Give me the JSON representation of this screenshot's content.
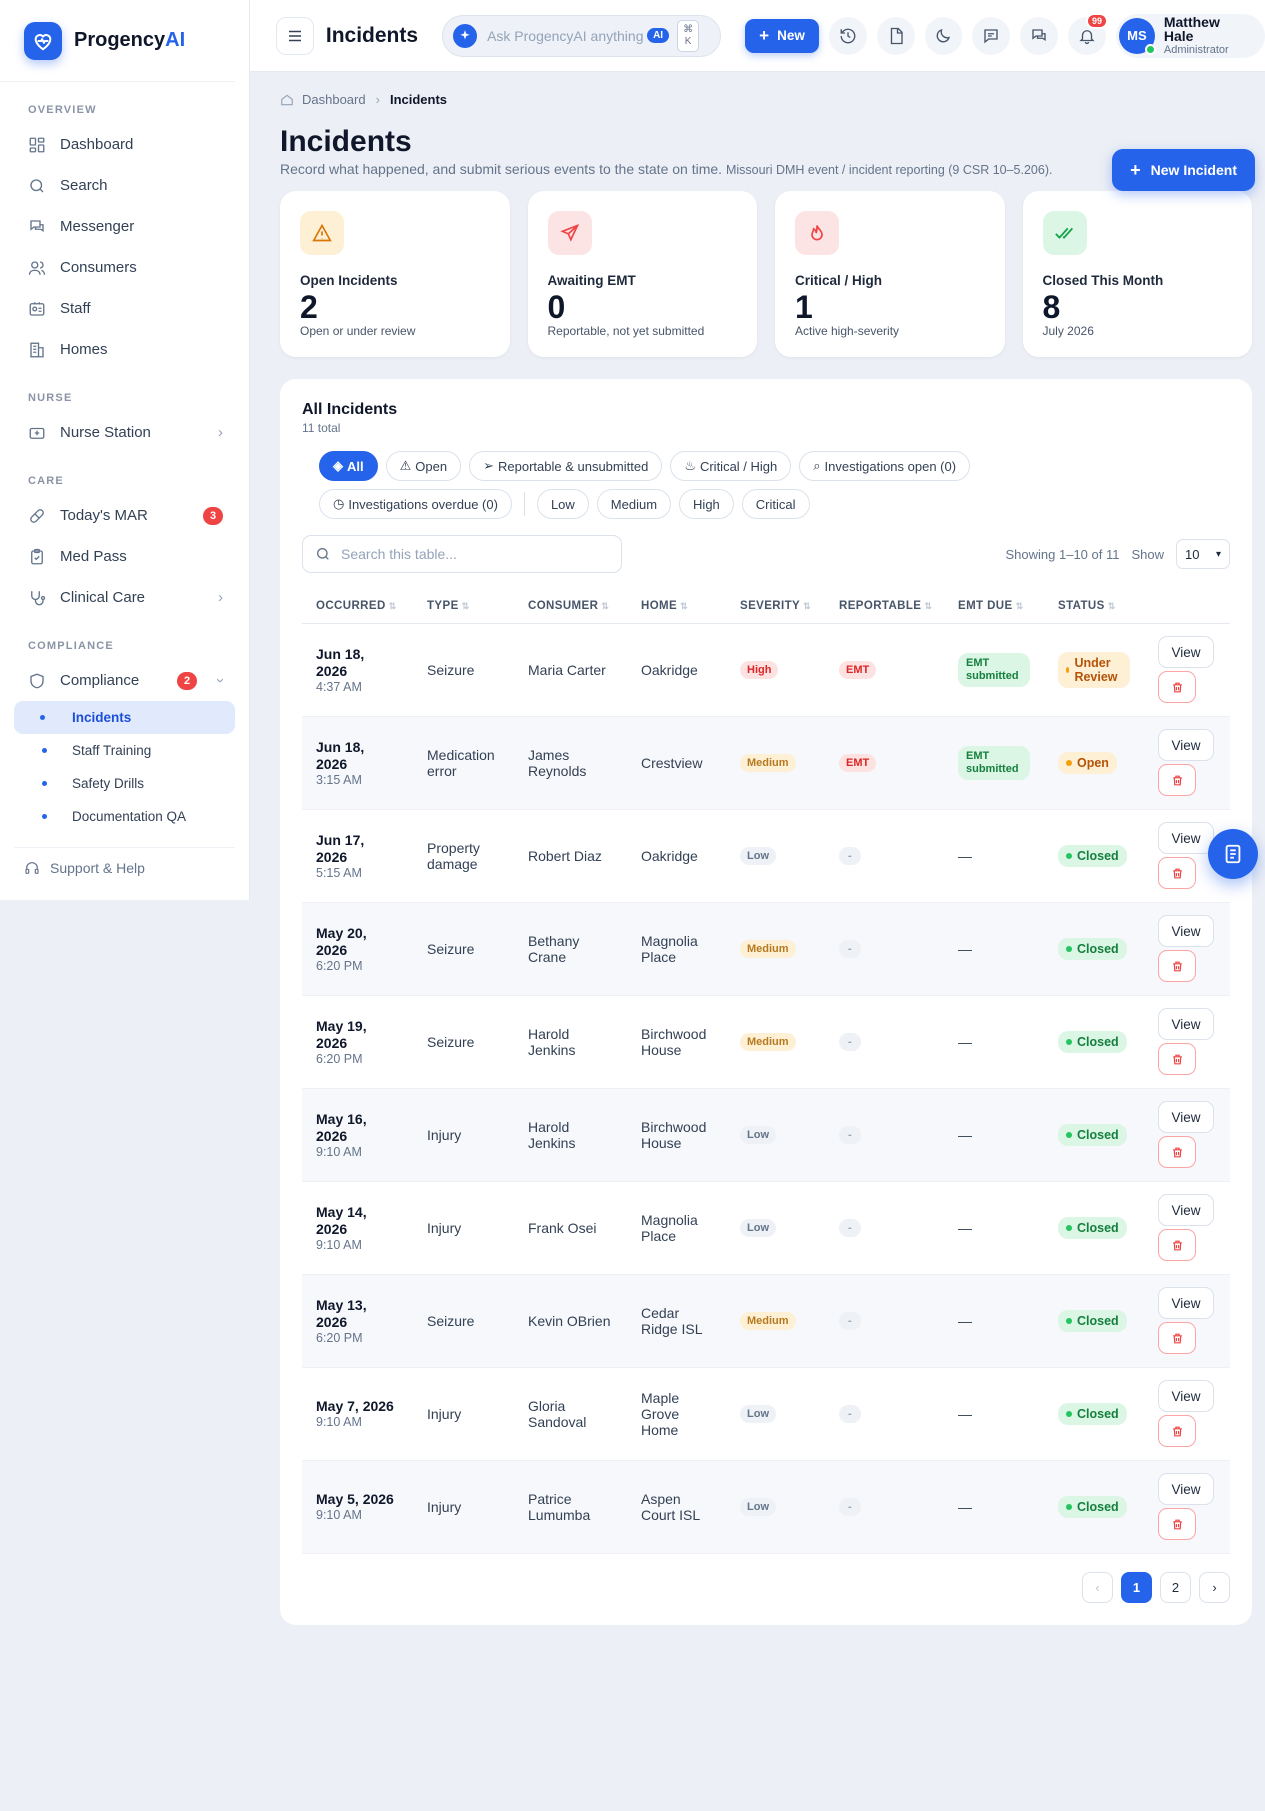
{
  "brand": {
    "name": "Progency",
    "name_accent": "AI"
  },
  "sidebar": {
    "sections": {
      "overview": "OVERVIEW",
      "nurse": "NURSE",
      "care": "CARE",
      "compliance": "COMPLIANCE"
    },
    "items": {
      "dashboard": "Dashboard",
      "search": "Search",
      "messenger": "Messenger",
      "consumers": "Consumers",
      "staff": "Staff",
      "homes": "Homes",
      "nurse_station": "Nurse Station",
      "todays_mar": "Today's MAR",
      "todays_mar_badge": "3",
      "med_pass": "Med Pass",
      "clinical_care": "Clinical Care",
      "compliance": "Compliance",
      "compliance_badge": "2"
    },
    "sub_items": {
      "incidents": "Incidents",
      "staff_training": "Staff Training",
      "safety_drills": "Safety Drills",
      "documentation_qa": "Documentation QA"
    },
    "support": "Support & Help"
  },
  "topbar": {
    "title": "Incidents",
    "ask_placeholder": "Ask ProgencyAI anything",
    "ai_label": "AI",
    "kbd_top": "⌘",
    "kbd_bottom": "K",
    "new_label": "New",
    "notification_count": "99",
    "user": {
      "initials": "MS",
      "name": "Matthew Hale",
      "role": "Administrator"
    }
  },
  "breadcrumb": {
    "home": "Dashboard",
    "current": "Incidents"
  },
  "page": {
    "title": "Incidents",
    "subtitle": "Record what happened, and submit serious events to the state on time.",
    "subtitle_small": "Missouri DMH event / incident reporting (9 CSR 10–5.206).",
    "new_incident": "New Incident"
  },
  "kpis": [
    {
      "label": "Open Incidents",
      "value": "2",
      "sub": "Open or under review",
      "icon": "warning-icon",
      "color": "#d97706",
      "bg": "#fdf0d5"
    },
    {
      "label": "Awaiting EMT",
      "value": "0",
      "sub": "Reportable, not yet submitted",
      "icon": "send-icon",
      "color": "#ef4444",
      "bg": "#fde4e4"
    },
    {
      "label": "Critical / High",
      "value": "1",
      "sub": "Active high-severity",
      "icon": "flame-icon",
      "color": "#ef4444",
      "bg": "#fde4e4"
    },
    {
      "label": "Closed This Month",
      "value": "8",
      "sub": "July 2026",
      "icon": "double-check-icon",
      "color": "#16a34a",
      "bg": "#dcf6e6"
    }
  ],
  "table_card": {
    "title": "All Incidents",
    "subtitle": "11 total",
    "filters": {
      "all": "All",
      "open": "Open",
      "reportable": "Reportable & unsubmitted",
      "critical": "Critical / High",
      "investigations_open": "Investigations open (0)",
      "investigations_overdue": "Investigations overdue (0)",
      "low": "Low",
      "medium": "Medium",
      "high": "High",
      "critical_only": "Critical"
    },
    "search_placeholder": "Search this table...",
    "showing": "Showing 1–10 of 11",
    "show_label": "Show",
    "page_size": "10",
    "columns": {
      "occurred": "OCCURRED",
      "type": "TYPE",
      "consumer": "CONSUMER",
      "home": "HOME",
      "severity": "SEVERITY",
      "reportable": "REPORTABLE",
      "emt_due": "EMT DUE",
      "status": "STATUS"
    },
    "view_label": "View",
    "rows": [
      {
        "date": "Jun 18, 2026",
        "time": "4:37 AM",
        "type": "Seizure",
        "consumer": "Maria Carter",
        "home": "Oakridge",
        "severity": "High",
        "reportable": "EMT",
        "emt_due": "EMT submitted",
        "status": "Under Review"
      },
      {
        "date": "Jun 18, 2026",
        "time": "3:15 AM",
        "type": "Medication error",
        "consumer": "James Reynolds",
        "home": "Crestview",
        "severity": "Medium",
        "reportable": "EMT",
        "emt_due": "EMT submitted",
        "status": "Open"
      },
      {
        "date": "Jun 17, 2026",
        "time": "5:15 AM",
        "type": "Property damage",
        "consumer": "Robert Diaz",
        "home": "Oakridge",
        "severity": "Low",
        "reportable": "-",
        "emt_due": "—",
        "status": "Closed"
      },
      {
        "date": "May 20, 2026",
        "time": "6:20 PM",
        "type": "Seizure",
        "consumer": "Bethany Crane",
        "home": "Magnolia Place",
        "severity": "Medium",
        "reportable": "-",
        "emt_due": "—",
        "status": "Closed"
      },
      {
        "date": "May 19, 2026",
        "time": "6:20 PM",
        "type": "Seizure",
        "consumer": "Harold Jenkins",
        "home": "Birchwood House",
        "severity": "Medium",
        "reportable": "-",
        "emt_due": "—",
        "status": "Closed"
      },
      {
        "date": "May 16, 2026",
        "time": "9:10 AM",
        "type": "Injury",
        "consumer": "Harold Jenkins",
        "home": "Birchwood House",
        "severity": "Low",
        "reportable": "-",
        "emt_due": "—",
        "status": "Closed"
      },
      {
        "date": "May 14, 2026",
        "time": "9:10 AM",
        "type": "Injury",
        "consumer": "Frank Osei",
        "home": "Magnolia Place",
        "severity": "Low",
        "reportable": "-",
        "emt_due": "—",
        "status": "Closed"
      },
      {
        "date": "May 13, 2026",
        "time": "6:20 PM",
        "type": "Seizure",
        "consumer": "Kevin OBrien",
        "home": "Cedar Ridge ISL",
        "severity": "Medium",
        "reportable": "-",
        "emt_due": "—",
        "status": "Closed"
      },
      {
        "date": "May 7, 2026",
        "time": "9:10 AM",
        "type": "Injury",
        "consumer": "Gloria Sandoval",
        "home": "Maple Grove Home",
        "severity": "Low",
        "reportable": "-",
        "emt_due": "—",
        "status": "Closed"
      },
      {
        "date": "May 5, 2026",
        "time": "9:10 AM",
        "type": "Injury",
        "consumer": "Patrice Lumumba",
        "home": "Aspen Court ISL",
        "severity": "Low",
        "reportable": "-",
        "emt_due": "—",
        "status": "Closed"
      }
    ],
    "pagination": {
      "prev": "‹",
      "pages": [
        "1",
        "2"
      ],
      "current": "1",
      "next": "›"
    }
  },
  "colors": {
    "accent": "#2563eb",
    "danger": "#ef4444",
    "success": "#16a34a",
    "warning": "#d97706"
  }
}
